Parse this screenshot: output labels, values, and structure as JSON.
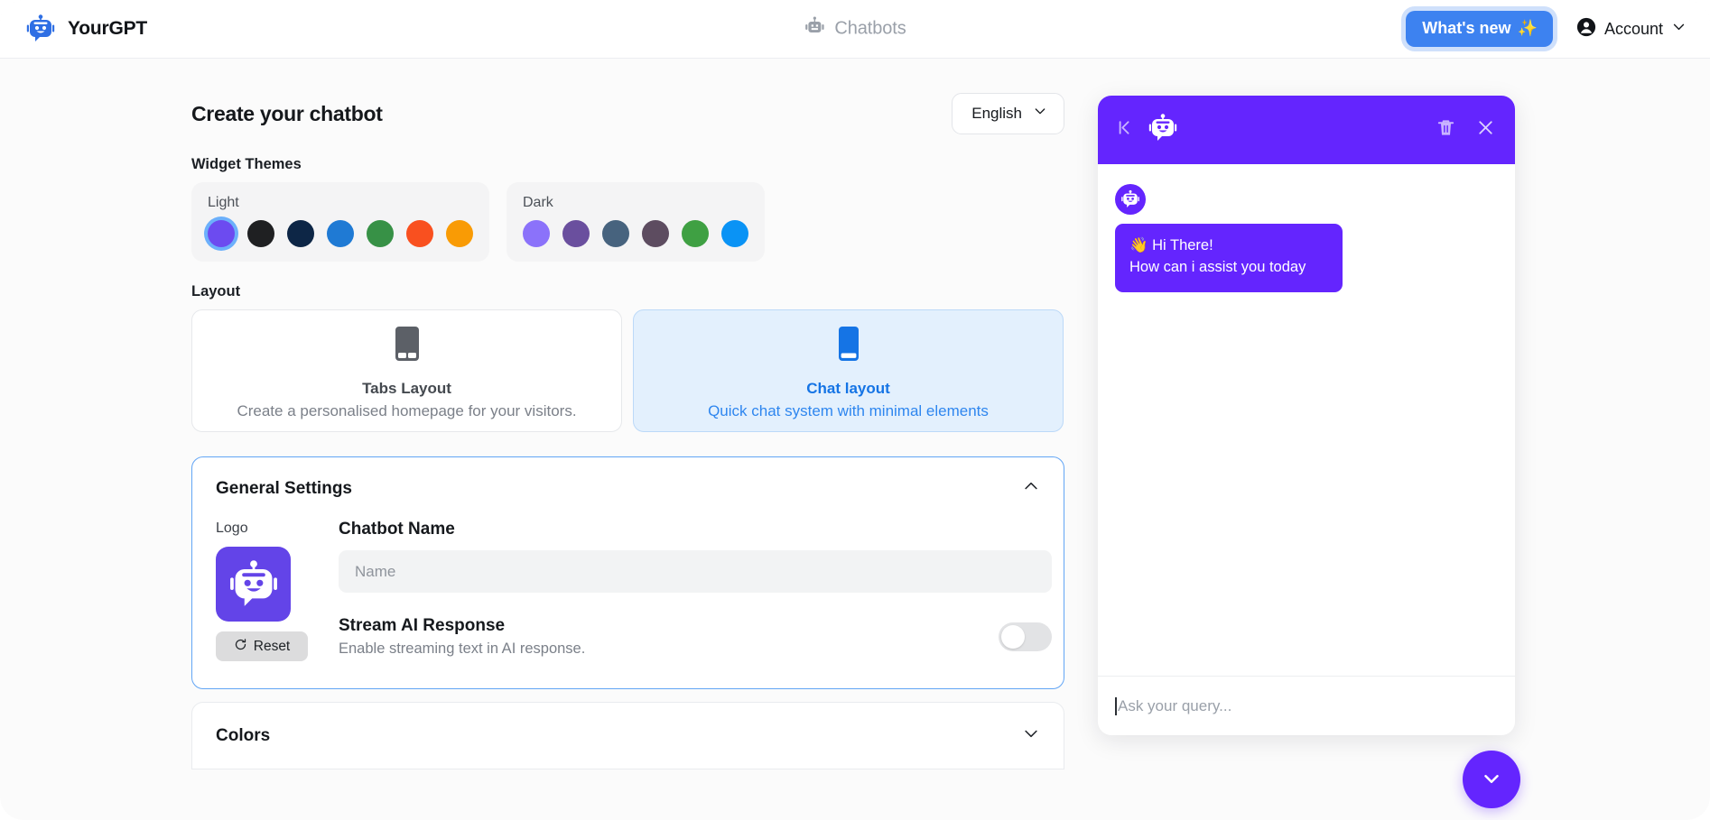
{
  "header": {
    "brand": "YourGPT",
    "nav_center": "Chatbots",
    "whats_new": "What's new",
    "whats_new_sparkle": "✨",
    "account": "Account"
  },
  "editor": {
    "page_title": "Create your chatbot",
    "language": "English",
    "widget_themes_label": "Widget Themes",
    "theme_groups": [
      {
        "name": "Light",
        "swatches": [
          {
            "color": "#6c4bf0",
            "selected": true
          },
          {
            "color": "#1f2022",
            "selected": false
          },
          {
            "color": "#0d2646",
            "selected": false
          },
          {
            "color": "#1f7ad4",
            "selected": false
          },
          {
            "color": "#379146",
            "selected": false
          },
          {
            "color": "#f9501f",
            "selected": false
          },
          {
            "color": "#f99b05",
            "selected": false
          }
        ]
      },
      {
        "name": "Dark",
        "swatches": [
          {
            "color": "#8b72fa",
            "selected": false
          },
          {
            "color": "#6a4f9e",
            "selected": false
          },
          {
            "color": "#47637e",
            "selected": false
          },
          {
            "color": "#5d4c60",
            "selected": false
          },
          {
            "color": "#3fa043",
            "selected": false
          },
          {
            "color": "#0a93f5",
            "selected": false
          }
        ]
      }
    ],
    "layout_label": "Layout",
    "layouts": [
      {
        "title": "Tabs Layout",
        "subtitle": "Create a personalised homepage for your visitors.",
        "selected": false
      },
      {
        "title": "Chat layout",
        "subtitle": "Quick chat system with minimal elements",
        "selected": true
      }
    ],
    "general_settings": {
      "title": "General Settings",
      "logo_label": "Logo",
      "reset_label": "Reset",
      "chatbot_name_label": "Chatbot Name",
      "chatbot_name_value": "",
      "chatbot_name_placeholder": "Name",
      "stream_title": "Stream AI Response",
      "stream_subtitle": "Enable streaming text in AI response.",
      "stream_enabled": false
    },
    "colors_section": {
      "title": "Colors",
      "expanded": false
    }
  },
  "widget_preview": {
    "accent_color": "#6425fe",
    "messages": [
      {
        "sender": "bot",
        "line1": "👋 Hi There!",
        "line2": "How can i assist you today"
      }
    ],
    "input_placeholder": "Ask your query...",
    "input_value": ""
  }
}
